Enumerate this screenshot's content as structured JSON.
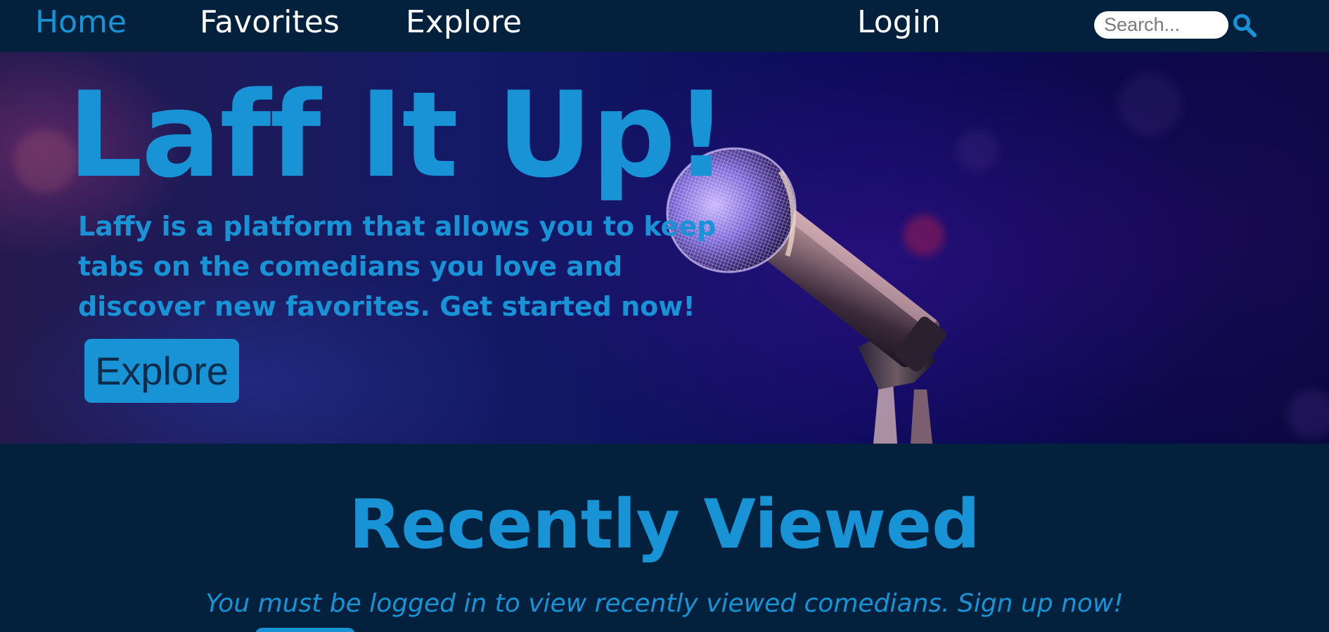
{
  "nav": {
    "home": "Home",
    "favorites": "Favorites",
    "explore": "Explore",
    "login": "Login",
    "search_placeholder": "Search..."
  },
  "hero": {
    "title": "Laff It Up!",
    "description": "Laffy is a platform that allows you to keep tabs on the comedians you love and discover new favorites. Get started now!",
    "button": "Explore"
  },
  "recent": {
    "title": "Recently Viewed",
    "message": "You must be logged in to view recently viewed comedians. Sign up now!"
  },
  "icons": {
    "search": "search-icon",
    "microphone": "microphone-illustration"
  },
  "colors": {
    "background": "#03213c",
    "accent": "#1793d6",
    "nav_text": "#ffffff"
  }
}
